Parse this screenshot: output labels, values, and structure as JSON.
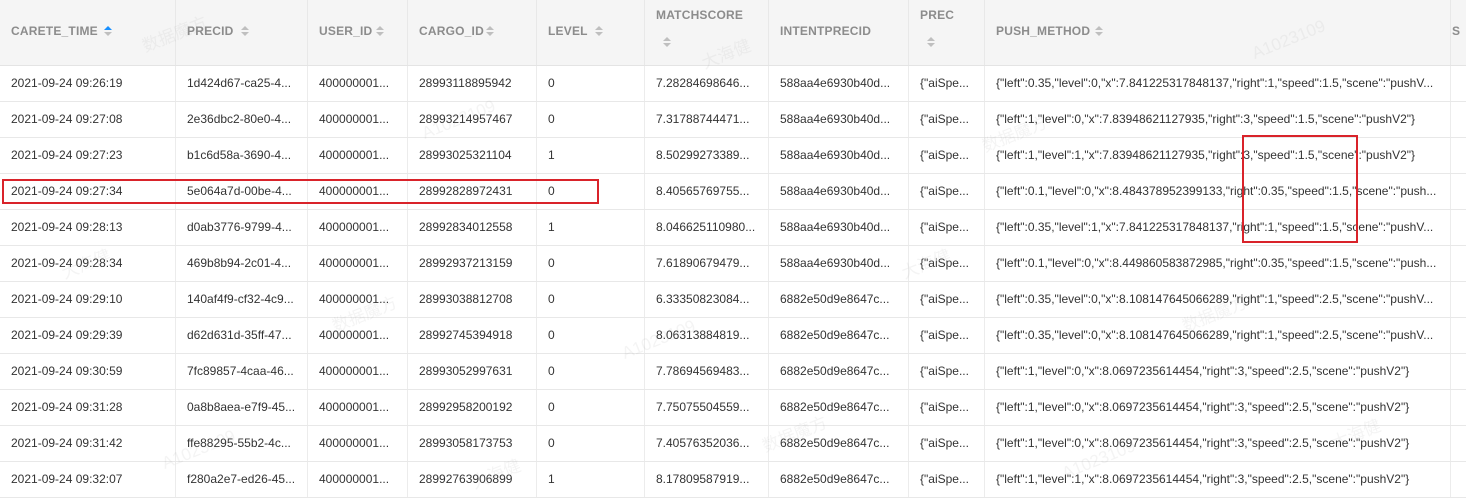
{
  "columns": [
    {
      "label": "CARETE_TIME",
      "sort": "asc"
    },
    {
      "label": "PRECID"
    },
    {
      "label": "USER_ID"
    },
    {
      "label": "CARGO_ID"
    },
    {
      "label": "LEVEL"
    },
    {
      "label": "MATCHSCORE"
    },
    {
      "label": "INTENTPRECID"
    },
    {
      "label": "PREC"
    },
    {
      "label": "PUSH_METHOD"
    },
    {
      "label": "S"
    }
  ],
  "rows": [
    [
      "2021-09-24 09:26:19",
      "1d424d67-ca25-4...",
      "400000001...",
      "28993118895942",
      "0",
      "7.28284698646...",
      "588aa4e6930b40d...",
      "{\"aiSpe...",
      "{\"left\":0.35,\"level\":0,\"x\":7.841225317848137,\"right\":1,\"speed\":1.5,\"scene\":\"pushV..."
    ],
    [
      "2021-09-24 09:27:08",
      "2e36dbc2-80e0-4...",
      "400000001...",
      "28993214957467",
      "0",
      "7.31788744471...",
      "588aa4e6930b40d...",
      "{\"aiSpe...",
      "{\"left\":1,\"level\":0,\"x\":7.83948621127935,\"right\":3,\"speed\":1.5,\"scene\":\"pushV2\"}"
    ],
    [
      "2021-09-24 09:27:23",
      "b1c6d58a-3690-4...",
      "400000001...",
      "28993025321104",
      "1",
      "8.50299273389...",
      "588aa4e6930b40d...",
      "{\"aiSpe...",
      "{\"left\":1,\"level\":1,\"x\":7.83948621127935,\"right\":3,\"speed\":1.5,\"scene\":\"pushV2\"}"
    ],
    [
      "2021-09-24 09:27:34",
      "5e064a7d-00be-4...",
      "400000001...",
      "28992828972431",
      "0",
      "8.40565769755...",
      "588aa4e6930b40d...",
      "{\"aiSpe...",
      "{\"left\":0.1,\"level\":0,\"x\":8.484378952399133,\"right\":0.35,\"speed\":1.5,\"scene\":\"push..."
    ],
    [
      "2021-09-24 09:28:13",
      "d0ab3776-9799-4...",
      "400000001...",
      "28992834012558",
      "1",
      "8.046625110980...",
      "588aa4e6930b40d...",
      "{\"aiSpe...",
      "{\"left\":0.35,\"level\":1,\"x\":7.841225317848137,\"right\":1,\"speed\":1.5,\"scene\":\"pushV..."
    ],
    [
      "2021-09-24 09:28:34",
      "469b8b94-2c01-4...",
      "400000001...",
      "28992937213159",
      "0",
      "7.61890679479...",
      "588aa4e6930b40d...",
      "{\"aiSpe...",
      "{\"left\":0.1,\"level\":0,\"x\":8.449860583872985,\"right\":0.35,\"speed\":1.5,\"scene\":\"push..."
    ],
    [
      "2021-09-24 09:29:10",
      "140af4f9-cf32-4c9...",
      "400000001...",
      "28993038812708",
      "0",
      "6.33350823084...",
      "6882e50d9e8647c...",
      "{\"aiSpe...",
      "{\"left\":0.35,\"level\":0,\"x\":8.108147645066289,\"right\":1,\"speed\":2.5,\"scene\":\"pushV..."
    ],
    [
      "2021-09-24 09:29:39",
      "d62d631d-35ff-47...",
      "400000001...",
      "28992745394918",
      "0",
      "8.06313884819...",
      "6882e50d9e8647c...",
      "{\"aiSpe...",
      "{\"left\":0.35,\"level\":0,\"x\":8.108147645066289,\"right\":1,\"speed\":2.5,\"scene\":\"pushV..."
    ],
    [
      "2021-09-24 09:30:59",
      "7fc89857-4caa-46...",
      "400000001...",
      "28993052997631",
      "0",
      "7.78694569483...",
      "6882e50d9e8647c...",
      "{\"aiSpe...",
      "{\"left\":1,\"level\":0,\"x\":8.0697235614454,\"right\":3,\"speed\":2.5,\"scene\":\"pushV2\"}"
    ],
    [
      "2021-09-24 09:31:28",
      "0a8b8aea-e7f9-45...",
      "400000001...",
      "28992958200192",
      "0",
      "7.75075504559...",
      "6882e50d9e8647c...",
      "{\"aiSpe...",
      "{\"left\":1,\"level\":0,\"x\":8.0697235614454,\"right\":3,\"speed\":2.5,\"scene\":\"pushV2\"}"
    ],
    [
      "2021-09-24 09:31:42",
      "ffe88295-55b2-4c...",
      "400000001...",
      "28993058173753",
      "0",
      "7.40576352036...",
      "6882e50d9e8647c...",
      "{\"aiSpe...",
      "{\"left\":1,\"level\":0,\"x\":8.0697235614454,\"right\":3,\"speed\":2.5,\"scene\":\"pushV2\"}"
    ],
    [
      "2021-09-24 09:32:07",
      "f280a2e7-ed26-45...",
      "400000001...",
      "28992763906899",
      "1",
      "8.17809587919...",
      "6882e50d9e8647c...",
      "{\"aiSpe...",
      "{\"left\":1,\"level\":1,\"x\":8.0697235614454,\"right\":3,\"speed\":2.5,\"scene\":\"pushV2\"}"
    ]
  ],
  "watermark": {
    "texts": [
      "数据魔方",
      "A1023109",
      "大海健"
    ]
  },
  "colors": {
    "highlight": "#d9232a",
    "sort_active": "#1890ff"
  }
}
